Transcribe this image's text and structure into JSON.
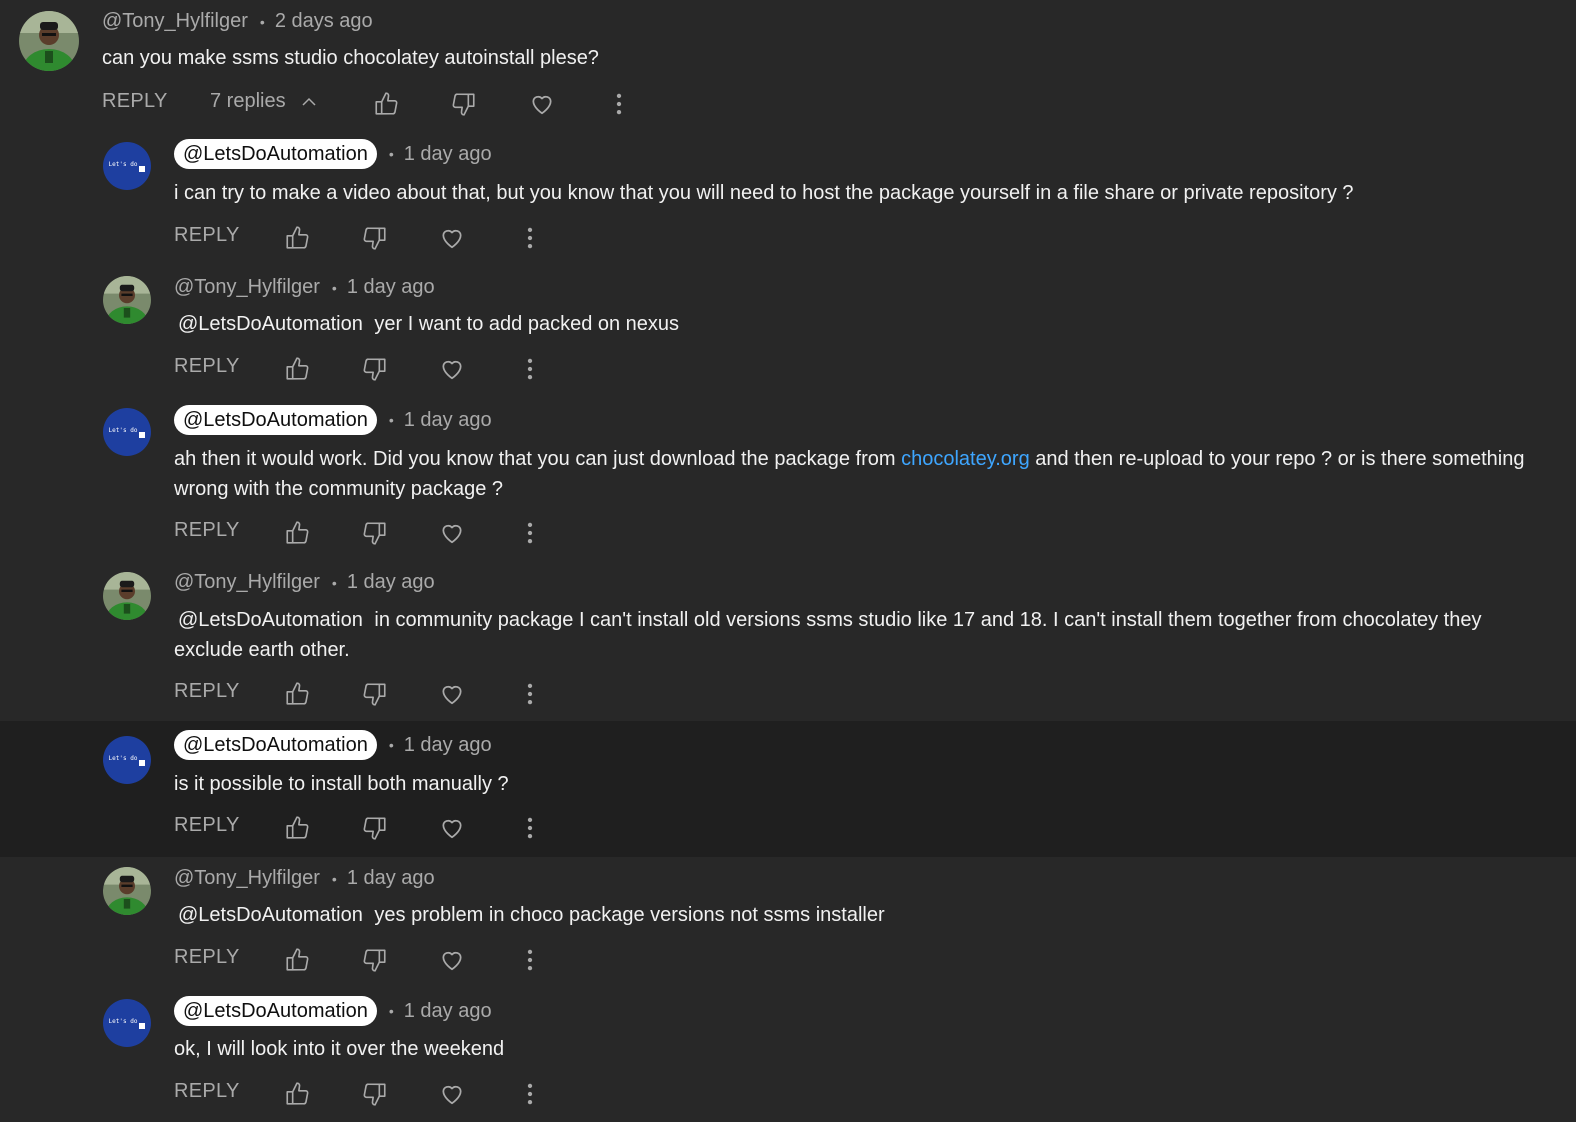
{
  "colors": {
    "background": "#282828",
    "highlight_background": "#1f1f1f",
    "link": "#3ea6ff",
    "secondary_text": "#aaaaaa",
    "avatar_lda": "#1e3fa0"
  },
  "top_comment": {
    "author": "@Tony_Hylfilger",
    "time": "2 days ago",
    "text": "can you make ssms studio chocolatey autoinstall plese?",
    "reply_label": "REPLY",
    "replies_toggle": "7 replies",
    "icons": [
      "like-icon",
      "dislike-icon",
      "heart-icon",
      "more-icon",
      "chevron-up-icon"
    ]
  },
  "replies": [
    {
      "author": "@LetsDoAutomation",
      "time": "1 day ago",
      "text": "i can try to make a video about that, but you know that you will need to host the package yourself in a file share or private repository ?",
      "reply_label": "REPLY"
    },
    {
      "author": "@Tony_Hylfilger",
      "time": "1 day ago",
      "mention": "@LetsDoAutomation",
      "text": "yer I want to add packed on nexus",
      "reply_label": "REPLY"
    },
    {
      "author": "@LetsDoAutomation",
      "time": "1 day ago",
      "text_before_link": "ah then it would work. Did you know that you can just download the package from",
      "link_text": "chocolatey.org",
      "text_after_link": "and then re-upload to your repo ? or is there something wrong with the community package ?",
      "reply_label": "REPLY"
    },
    {
      "author": "@Tony_Hylfilger",
      "time": "1 day ago",
      "mention": "@LetsDoAutomation",
      "text": "in community package I can't install old versions ssms studio like 17 and 18. I can't install them together from chocolatey they exclude earth other.",
      "reply_label": "REPLY"
    },
    {
      "author": "@LetsDoAutomation",
      "time": "1 day ago",
      "text": "is it possible to install both manually ?",
      "reply_label": "REPLY"
    },
    {
      "author": "@Tony_Hylfilger",
      "time": "1 day ago",
      "mention": "@LetsDoAutomation",
      "text": "yes problem in choco package versions not ssms installer",
      "reply_label": "REPLY"
    },
    {
      "author": "@LetsDoAutomation",
      "time": "1 day ago",
      "text": "ok, I will look into it over the weekend",
      "reply_label": "REPLY"
    }
  ],
  "avatar_lda_label": "Let's do"
}
